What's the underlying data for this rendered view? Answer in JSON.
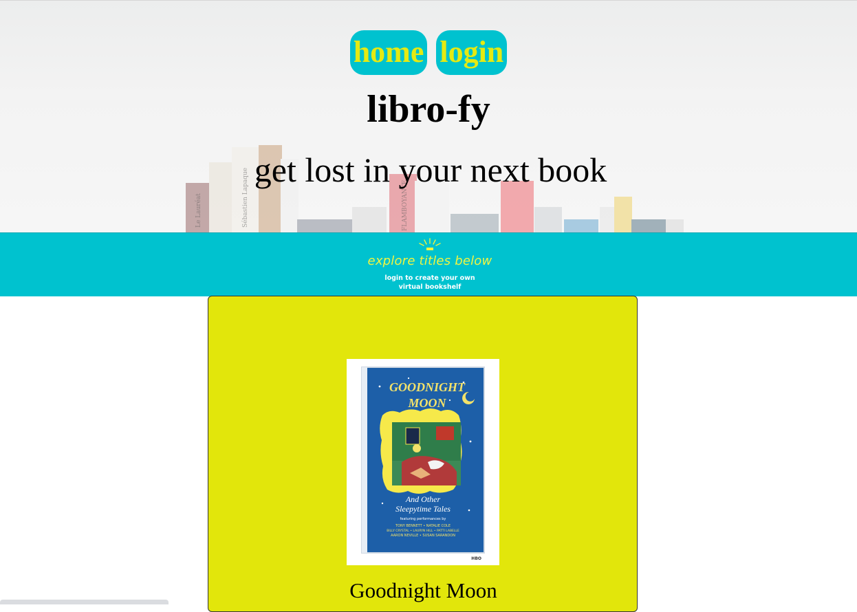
{
  "nav": {
    "home_label": "home",
    "login_label": "login"
  },
  "header": {
    "title": "libro-fy",
    "tagline": "get lost in your next book"
  },
  "banner": {
    "heading": "explore titles below",
    "subtext": "login to create your own virtual bookshelf",
    "icon": "sunrise-icon"
  },
  "book": {
    "title": "Goodnight Moon",
    "cover": {
      "title_line1": "GOODNIGHT",
      "title_line2": "MOON",
      "subtitle_line1": "And Other",
      "subtitle_line2": "Sleepytime Tales",
      "featuring": "featuring performances by",
      "credits_line1": "TONY BENNETT • NATALIE COLE",
      "credits_line2": "BILLY CRYSTAL • LAURYN HILL • PATTI LABELLE",
      "credits_line3": "AARON NEVILLE • SUSAN SARANDON",
      "brand": "HBO"
    }
  },
  "shelf_spines": [
    "Sébastien Lapaque",
    "FLAMBOYANTE",
    "Le Lauréat"
  ],
  "colors": {
    "accent_cyan": "#00c2cf",
    "accent_yellow": "#e4ea12",
    "card_yellow": "#e2e60b",
    "cover_blue": "#1d5fa8"
  }
}
